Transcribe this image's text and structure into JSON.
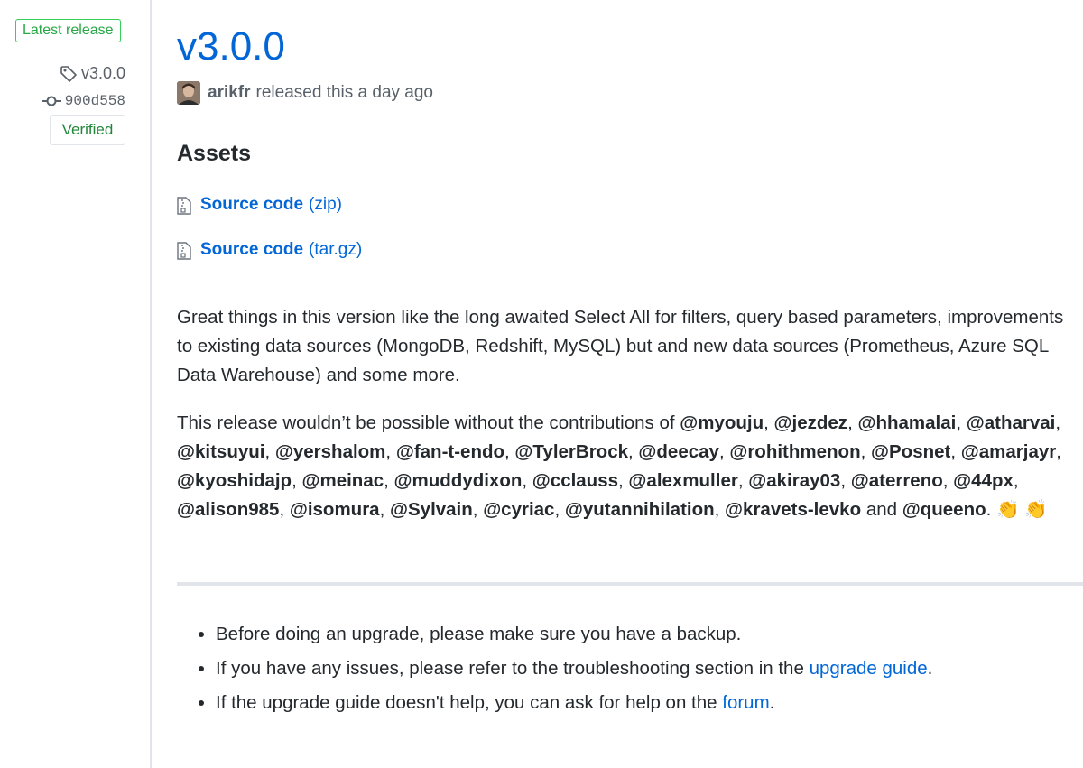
{
  "sidebar": {
    "latest_label": "Latest release",
    "tag": "v3.0.0",
    "commit": "900d558",
    "verified_label": "Verified"
  },
  "release": {
    "title": "v3.0.0",
    "author": "arikfr",
    "released_text": "released this a day ago"
  },
  "assets": {
    "heading": "Assets",
    "items": [
      {
        "label": "Source code",
        "format": "(zip)"
      },
      {
        "label": "Source code",
        "format": "(tar.gz)"
      }
    ]
  },
  "body": {
    "intro": "Great things in this version like the long awaited Select All for filters, query based parameters, improvements to existing data sources (MongoDB, Redshift, MySQL) but and new data sources (Prometheus, Azure SQL Data Warehouse) and some more.",
    "thanks_prefix": "This release wouldn’t be possible without the contributions of",
    "contributors": [
      "@myouju",
      "@jezdez",
      "@hhamalai",
      "@atharvai",
      "@kitsuyui",
      "@yershalom",
      "@fan-t-endo",
      "@TylerBrock",
      "@deecay",
      "@rohithmenon",
      "@Posnet",
      "@amarjayr",
      "@kyoshidajp",
      "@meinac",
      "@muddydixon",
      "@cclauss",
      "@alexmuller",
      "@akiray03",
      "@aterreno",
      "@44px",
      "@alison985",
      "@isomura",
      "@Sylvain",
      "@cyriac",
      "@yutannihilation",
      "@kravets-levko"
    ],
    "and_word": "and",
    "last_contributor": "@queeno",
    "clap_emoji": "👏 👏"
  },
  "notes": {
    "item1": "Before doing an upgrade, please make sure you have a backup.",
    "item2_prefix": "If you have any issues, please refer to the troubleshooting section in the",
    "item2_link": "upgrade guide",
    "item3_prefix": "If the upgrade guide doesn't help, you can ask for help on the",
    "item3_link": "forum"
  }
}
